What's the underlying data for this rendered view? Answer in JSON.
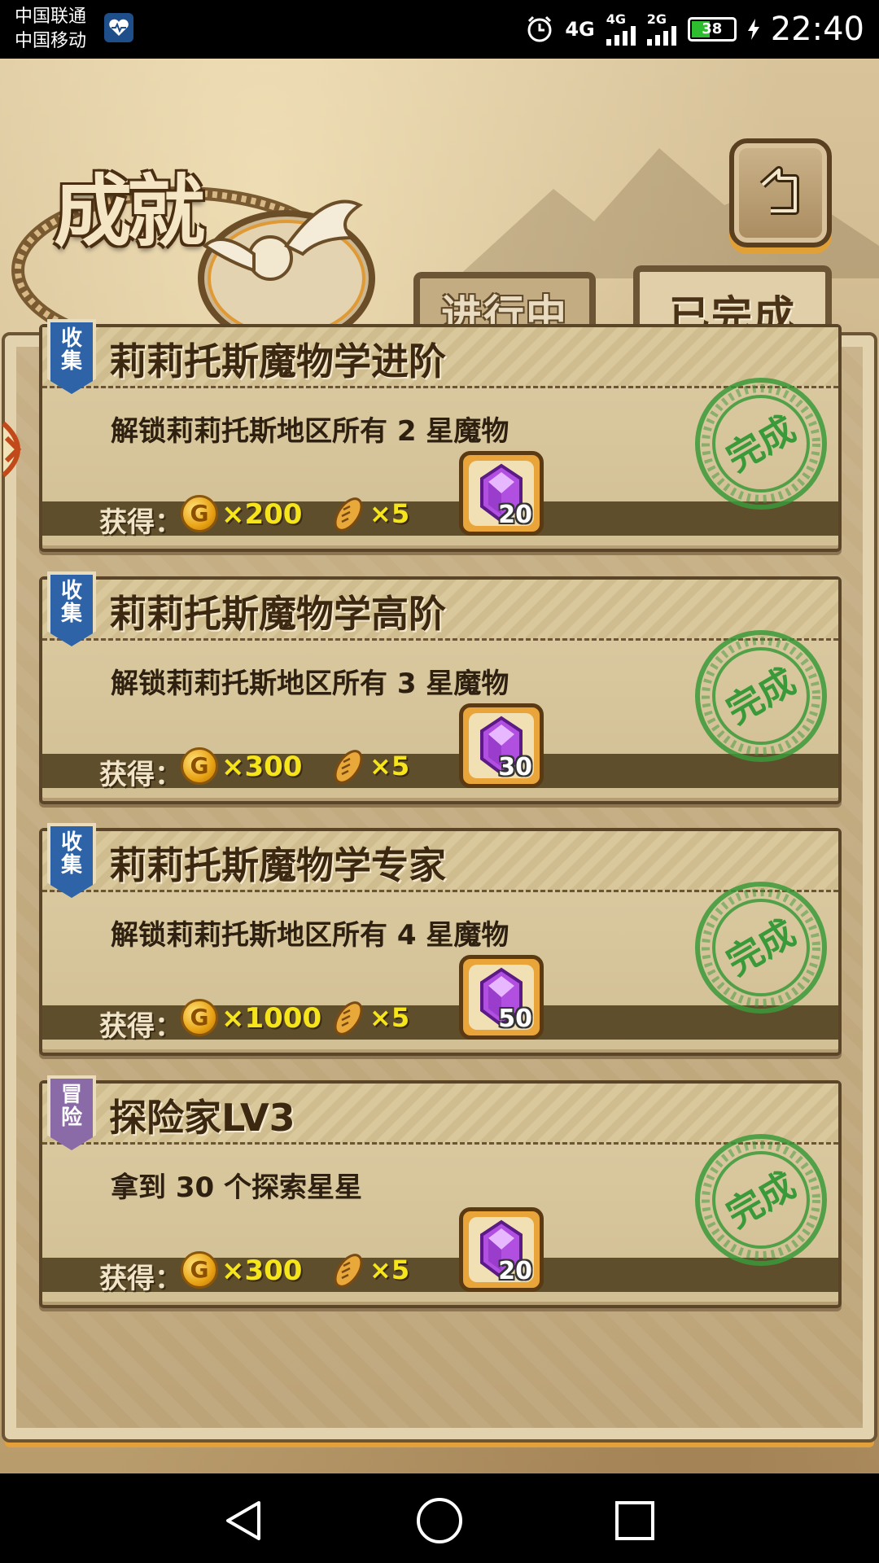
{
  "status_bar": {
    "carrier1": "中国联通",
    "carrier2": "中国移动",
    "net1": "4G",
    "net2": "4G",
    "net3": "2G",
    "battery": "38",
    "time": "22:40"
  },
  "header": {
    "title": "成就",
    "tab_in_progress": "进行中",
    "tab_completed": "已完成"
  },
  "reward_label": "获得：",
  "stamp_text": "完成",
  "achievements": [
    {
      "category": "收集",
      "category_lines": [
        "收",
        "集"
      ],
      "title": "莉莉托斯魔物学进阶",
      "desc": "解锁莉莉托斯地区所有 2 星魔物",
      "coins": "×200",
      "bread": "×5",
      "gems": "20"
    },
    {
      "category": "收集",
      "category_lines": [
        "收",
        "集"
      ],
      "title": "莉莉托斯魔物学高阶",
      "desc": "解锁莉莉托斯地区所有 3 星魔物",
      "coins": "×300",
      "bread": "×5",
      "gems": "30"
    },
    {
      "category": "收集",
      "category_lines": [
        "收",
        "集"
      ],
      "title": "莉莉托斯魔物学专家",
      "desc": "解锁莉莉托斯地区所有 4 星魔物",
      "coins": "×1000",
      "bread": "×5",
      "gems": "50"
    },
    {
      "category": "冒险",
      "category_lines": [
        "冒",
        "险"
      ],
      "title": "探险家LV3",
      "desc": "拿到 30 个探索星星",
      "coins": "×300",
      "bread": "×5",
      "gems": "20"
    }
  ],
  "colors": {
    "collect": "#2f63a8",
    "adventure": "#8b6aa8",
    "reward_text": "#f5e51a",
    "stamp": "#3a9a3a"
  }
}
